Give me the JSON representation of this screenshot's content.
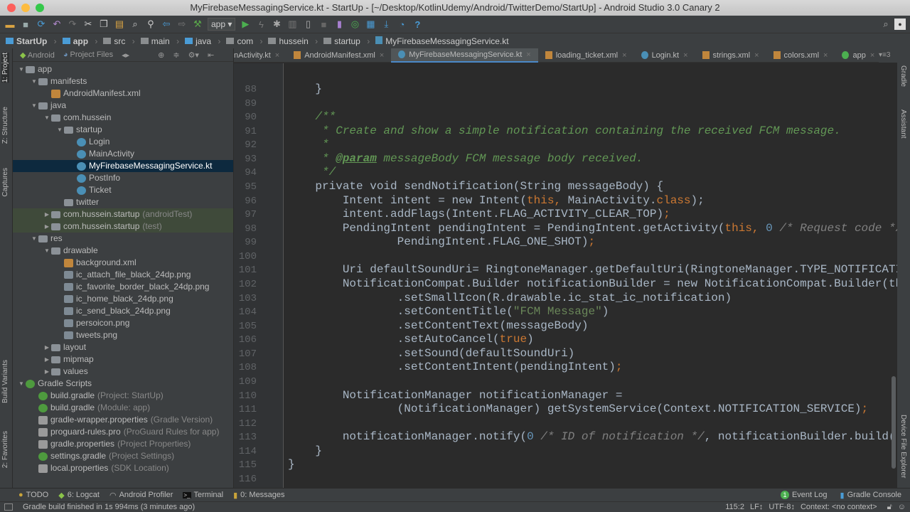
{
  "window": {
    "title": "MyFirebaseMessagingService.kt - StartUp - [~/Desktop/KotlinUdemy/Android/TwitterDemo/StartUp] - Android Studio 3.0 Canary 2"
  },
  "toolbar": {
    "run_config": "app"
  },
  "breadcrumbs": [
    "StartUp",
    "app",
    "src",
    "main",
    "java",
    "com",
    "hussein",
    "startup",
    "MyFirebaseMessagingService.kt"
  ],
  "left_strip": {
    "project": "1: Project",
    "structure": "Z: Structure",
    "captures": "Captures",
    "build_variants": "Build Variants",
    "favorites": "2: Favorites"
  },
  "right_strip": {
    "gradle": "Gradle",
    "assistant": "Assistant",
    "device_file_explorer": "Device File Explorer"
  },
  "project_panel": {
    "view_android": "Android",
    "view_project_files": "Project Files"
  },
  "tree": [
    {
      "label": "app",
      "level": 0,
      "arrow": "down",
      "icon": "folder"
    },
    {
      "label": "manifests",
      "level": 1,
      "arrow": "down",
      "icon": "folder"
    },
    {
      "label": "AndroidManifest.xml",
      "level": 2,
      "icon": "xml"
    },
    {
      "label": "java",
      "level": 1,
      "arrow": "down",
      "icon": "folder"
    },
    {
      "label": "com.hussein",
      "level": 2,
      "arrow": "down",
      "icon": "pkg"
    },
    {
      "label": "startup",
      "level": 3,
      "arrow": "down",
      "icon": "pkg"
    },
    {
      "label": "Login",
      "level": 4,
      "icon": "kt"
    },
    {
      "label": "MainActivity",
      "level": 4,
      "icon": "kt"
    },
    {
      "label": "MyFirebaseMessagingService.kt",
      "level": 4,
      "icon": "kt",
      "selected": true
    },
    {
      "label": "PostInfo",
      "level": 4,
      "icon": "kt"
    },
    {
      "label": "Ticket",
      "level": 4,
      "icon": "kt"
    },
    {
      "label": "twitter",
      "level": 3,
      "icon": "pkg"
    },
    {
      "label": "com.hussein.startup",
      "hint": "(androidTest)",
      "level": 2,
      "arrow": "right",
      "icon": "pkg",
      "highlight": true
    },
    {
      "label": "com.hussein.startup",
      "hint": "(test)",
      "level": 2,
      "arrow": "right",
      "icon": "pkg",
      "highlight": true
    },
    {
      "label": "res",
      "level": 1,
      "arrow": "down",
      "icon": "folder"
    },
    {
      "label": "drawable",
      "level": 2,
      "arrow": "down",
      "icon": "folder"
    },
    {
      "label": "background.xml",
      "level": 3,
      "icon": "xml"
    },
    {
      "label": "ic_attach_file_black_24dp.png",
      "level": 3,
      "icon": "img"
    },
    {
      "label": "ic_favorite_border_black_24dp.png",
      "level": 3,
      "icon": "img"
    },
    {
      "label": "ic_home_black_24dp.png",
      "level": 3,
      "icon": "img"
    },
    {
      "label": "ic_send_black_24dp.png",
      "level": 3,
      "icon": "img"
    },
    {
      "label": "persoicon.png",
      "level": 3,
      "icon": "img"
    },
    {
      "label": "tweets.png",
      "level": 3,
      "icon": "img"
    },
    {
      "label": "layout",
      "level": 2,
      "arrow": "right",
      "icon": "folder"
    },
    {
      "label": "mipmap",
      "level": 2,
      "arrow": "right",
      "icon": "folder"
    },
    {
      "label": "values",
      "level": 2,
      "arrow": "right",
      "icon": "folder"
    },
    {
      "label": "Gradle Scripts",
      "level": 0,
      "arrow": "down",
      "icon": "gr"
    },
    {
      "label": "build.gradle",
      "hint": "(Project: StartUp)",
      "level": 1,
      "icon": "gr"
    },
    {
      "label": "build.gradle",
      "hint": "(Module: app)",
      "level": 1,
      "icon": "gr"
    },
    {
      "label": "gradle-wrapper.properties",
      "hint": "(Gradle Version)",
      "level": 1,
      "icon": "prop"
    },
    {
      "label": "proguard-rules.pro",
      "hint": "(ProGuard Rules for app)",
      "level": 1,
      "icon": "prop"
    },
    {
      "label": "gradle.properties",
      "hint": "(Project Properties)",
      "level": 1,
      "icon": "prop"
    },
    {
      "label": "settings.gradle",
      "hint": "(Project Settings)",
      "level": 1,
      "icon": "gr"
    },
    {
      "label": "local.properties",
      "hint": "(SDK Location)",
      "level": 1,
      "icon": "prop"
    }
  ],
  "tabs": [
    {
      "label": "nActivity.kt",
      "icon": "kt"
    },
    {
      "label": "AndroidManifest.xml",
      "icon": "xml"
    },
    {
      "label": "MyFirebaseMessagingService.kt",
      "icon": "kt",
      "active": true
    },
    {
      "label": "loading_ticket.xml",
      "icon": "xml"
    },
    {
      "label": "Login.kt",
      "icon": "kt"
    },
    {
      "label": "strings.xml",
      "icon": "xml"
    },
    {
      "label": "colors.xml",
      "icon": "xml"
    },
    {
      "label": "app",
      "icon": "gr"
    }
  ],
  "tabs_overflow": "3",
  "code": [
    {
      "n": "88",
      "t": [
        [
          "    }",
          "p"
        ]
      ]
    },
    {
      "n": "89",
      "t": []
    },
    {
      "n": "90",
      "t": [
        [
          "    /**",
          "cm"
        ]
      ]
    },
    {
      "n": "91",
      "t": [
        [
          "     * Create and show a simple notification containing the received FCM message.",
          "cm"
        ]
      ]
    },
    {
      "n": "92",
      "t": [
        [
          "     *",
          "cm"
        ]
      ]
    },
    {
      "n": "93",
      "t": [
        [
          "     * ",
          "cm"
        ],
        [
          "@param",
          "tag"
        ],
        [
          " messageBody FCM message body received.",
          "cm"
        ]
      ]
    },
    {
      "n": "94",
      "t": [
        [
          "     */",
          "cm"
        ]
      ]
    },
    {
      "n": "95",
      "t": [
        [
          "    private void sendNotification(String messageBody) {",
          "p"
        ]
      ]
    },
    {
      "n": "96",
      "t": [
        [
          "        Intent intent = new Intent(",
          "p"
        ],
        [
          "this,",
          "kw"
        ],
        [
          " MainActivity.",
          "p"
        ],
        [
          "class",
          "kw"
        ],
        [
          ");",
          "p"
        ]
      ]
    },
    {
      "n": "97",
      "t": [
        [
          "        intent.addFlags(Intent.FLAG_ACTIVITY_CLEAR_TOP)",
          "p"
        ],
        [
          ";",
          "kw"
        ]
      ]
    },
    {
      "n": "98",
      "t": [
        [
          "        PendingIntent pendingIntent = PendingIntent.getActivity(",
          "p"
        ],
        [
          "this, ",
          "kw"
        ],
        [
          "0",
          "num"
        ],
        [
          " /* Request code */",
          "gcm"
        ]
      ]
    },
    {
      "n": "99",
      "t": [
        [
          "                PendingIntent.FLAG_ONE_SHOT)",
          "p"
        ],
        [
          ";",
          "kw"
        ]
      ]
    },
    {
      "n": "100",
      "t": []
    },
    {
      "n": "101",
      "t": [
        [
          "        Uri defaultSoundUri= RingtoneManager.getDefaultUri(RingtoneManager.TYPE_NOTIFICATION);",
          "p"
        ]
      ]
    },
    {
      "n": "102",
      "t": [
        [
          "        NotificationCompat.Builder notificationBuilder = new NotificationCompat.Builder(this)",
          "p"
        ]
      ]
    },
    {
      "n": "103",
      "t": [
        [
          "                .setSmallIcon(R.drawable.ic_stat_ic_notification)",
          "p"
        ]
      ]
    },
    {
      "n": "104",
      "t": [
        [
          "                .setContentTitle(",
          "p"
        ],
        [
          "\"FCM Message\"",
          "str"
        ],
        [
          ")",
          "p"
        ]
      ]
    },
    {
      "n": "105",
      "t": [
        [
          "                .setContentText(messageBody)",
          "p"
        ]
      ]
    },
    {
      "n": "106",
      "t": [
        [
          "                .setAutoCancel(",
          "p"
        ],
        [
          "true",
          "kw"
        ],
        [
          ")",
          "p"
        ]
      ]
    },
    {
      "n": "107",
      "t": [
        [
          "                .setSound(defaultSoundUri)",
          "p"
        ]
      ]
    },
    {
      "n": "108",
      "t": [
        [
          "                .setContentIntent(pendingIntent)",
          "p"
        ],
        [
          ";",
          "kw"
        ]
      ]
    },
    {
      "n": "109",
      "t": []
    },
    {
      "n": "110",
      "t": [
        [
          "        NotificationManager notificationManager =",
          "p"
        ]
      ]
    },
    {
      "n": "111",
      "t": [
        [
          "                (NotificationManager) getSystemService(Context.NOTIFICATION_SERVICE)",
          "p"
        ],
        [
          ";",
          "kw"
        ]
      ]
    },
    {
      "n": "112",
      "t": []
    },
    {
      "n": "113",
      "t": [
        [
          "        notificationManager.notify(",
          "p"
        ],
        [
          "0",
          "num"
        ],
        [
          " /* ID of notification */",
          "gcm"
        ],
        [
          ", notificationBuilder.build());",
          "p"
        ]
      ]
    },
    {
      "n": "114",
      "t": [
        [
          "    }",
          "p"
        ]
      ]
    },
    {
      "n": "115",
      "t": [
        [
          "}",
          "p"
        ]
      ]
    },
    {
      "n": "116",
      "t": []
    }
  ],
  "bottom_tools": {
    "todo": "TODO",
    "logcat": "6: Logcat",
    "profiler": "Android Profiler",
    "terminal": "Terminal",
    "messages": "0: Messages",
    "event_log": "Event Log",
    "event_count": "1",
    "gradle_console": "Gradle Console"
  },
  "status": {
    "message": "Gradle build finished in 1s 994ms (3 minutes ago)",
    "position": "115:2",
    "line_sep": "LF↕",
    "encoding": "UTF-8↕",
    "context": "Context: <no context>"
  }
}
